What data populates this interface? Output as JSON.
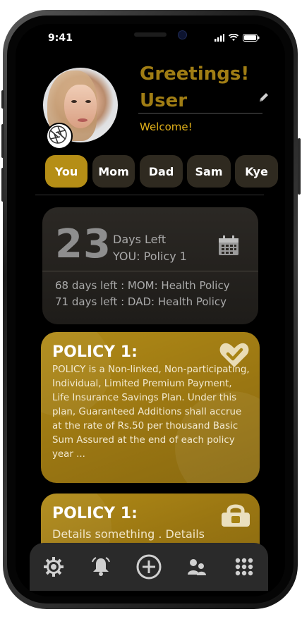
{
  "status": {
    "time": "9:41"
  },
  "profile": {
    "greeting_line1": "Greetings!",
    "greeting_line2": "User",
    "welcome": "Welcome!"
  },
  "members": [
    "You",
    "Mom",
    "Dad",
    "Sam",
    "Kye"
  ],
  "active_member": "You",
  "countdown": {
    "days": "23",
    "days_label": "Days Left",
    "policy_label": "YOU: Policy 1",
    "others": [
      "68 days left : MOM: Health Policy",
      "71 days left : DAD: Health Policy"
    ]
  },
  "policies": [
    {
      "title": "POLICY 1:",
      "body": "POLICY is a Non-linked, Non-participating, Individual, Limited Premium Payment, Life Insurance Savings Plan. Under this plan, Guaranteed Additions shall accrue at the rate of Rs.50 per thousand Basic Sum Assured at the end of each policy year ...",
      "icon": "badge-check-icon"
    },
    {
      "title": "POLICY 1:",
      "body": "Details something . Details",
      "icon": "lock-icon"
    }
  ],
  "nav": [
    "settings-icon",
    "bell-icon",
    "add-circle-icon",
    "family-icon",
    "apps-grid-icon"
  ],
  "colors": {
    "accent": "#b58e16",
    "greeting": "#a07d14",
    "welcome": "#e0b01a",
    "card": "#2b2824",
    "nav": "#2a2a2a"
  }
}
